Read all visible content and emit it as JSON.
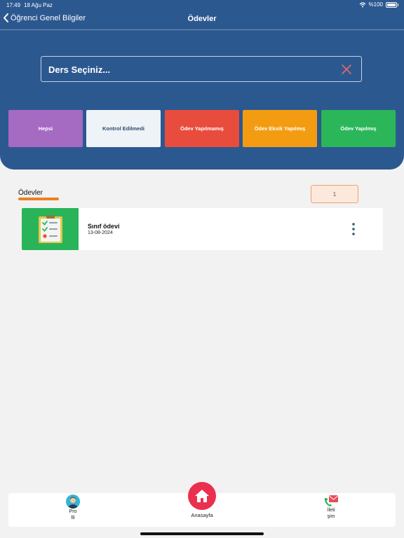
{
  "status_bar": {
    "time": "17:49",
    "date": "18 Ağu Paz",
    "battery_text": "%100",
    "battery_level": 1.0
  },
  "nav": {
    "back_label": "Öğrenci Genel Bilgiler",
    "title": "Ödevler"
  },
  "course_select": {
    "label": "Ders Seçiniz..."
  },
  "filters": [
    {
      "label": "Hepsi",
      "color": "#a56ac2",
      "text_color": "#ffffff"
    },
    {
      "label": "Kontrol Edilmedi",
      "color": "#eef3f7",
      "text_color": "#2c4a6b"
    },
    {
      "label": "Ödev Yapılmamış",
      "color": "#e84c3d",
      "text_color": "#ffffff"
    },
    {
      "label": "Ödev Eksik Yapılmış",
      "color": "#f39c12",
      "text_color": "#ffffff"
    },
    {
      "label": "Ödev Yapılmış",
      "color": "#2bb65a",
      "text_color": "#ffffff"
    }
  ],
  "section": {
    "title": "Ödevler",
    "page_number": "1"
  },
  "homeworks": [
    {
      "title": "Sınıf ödevi",
      "date": "13-08-2024",
      "thumb_icon": "checklist-icon"
    }
  ],
  "bottom_nav": {
    "profile_label": "Pro fil",
    "home_label": "Anasayfa",
    "contact_label": "İleti şim"
  },
  "colors": {
    "header_bg": "#2c5890",
    "accent": "#f07f22",
    "home_button": "#ea2f4f",
    "page_bg": "#f2f2f2"
  }
}
